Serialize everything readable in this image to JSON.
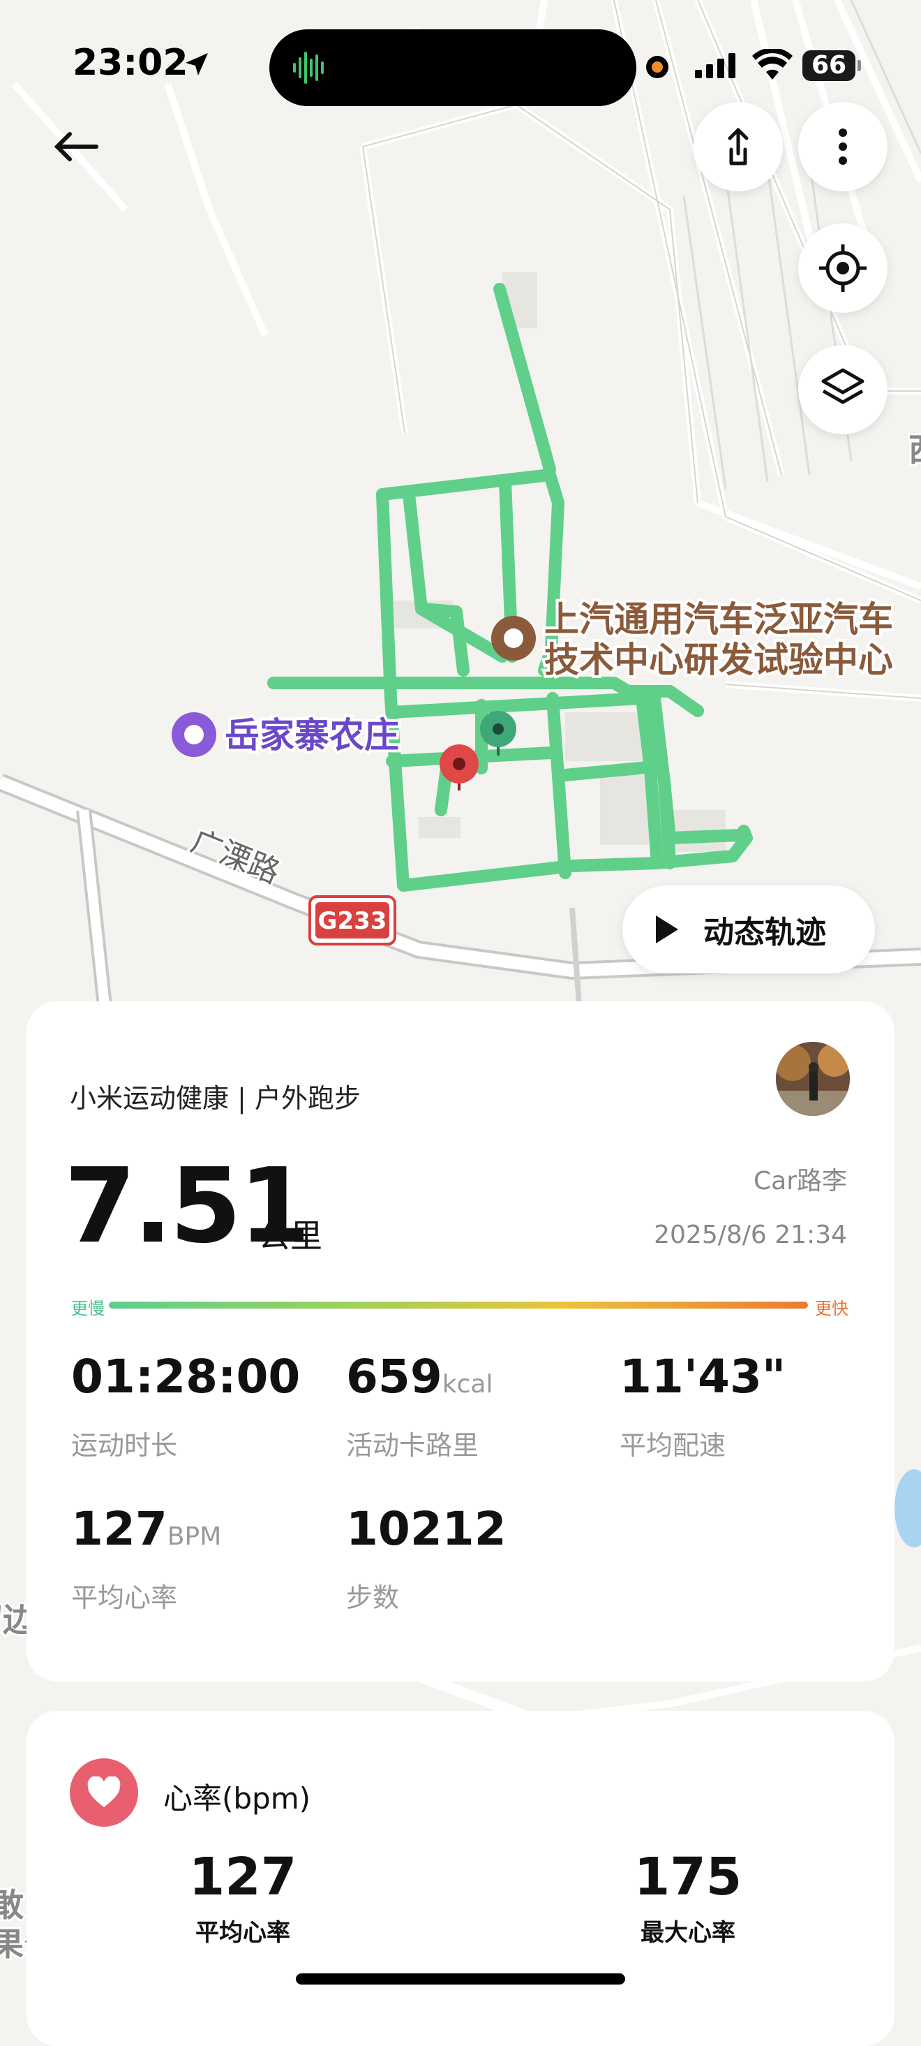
{
  "status_bar": {
    "time": "23:02",
    "battery": "66"
  },
  "map": {
    "poi_1": "上汽通用汽车泛亚汽车",
    "poi_1_line2": "技术中心研发试验中心",
    "poi_2": "岳家寨农庄",
    "road_name": "广溧路",
    "road_badge": "G233",
    "edge_text_1": "西",
    "edge_text_2": "留边",
    "edge_text_3": "敢",
    "edge_text_4": "果公",
    "route_color": "#5fcf8a"
  },
  "controls": {
    "back_icon": "arrow-left-icon",
    "share_icon": "share-icon",
    "more_icon": "more-vertical-icon",
    "locate_icon": "locate-icon",
    "layers_icon": "layers-icon",
    "dynamic_track_label": "动态轨迹"
  },
  "summary": {
    "app_title": "小米运动健康 | 户外跑步",
    "distance": "7.51",
    "distance_unit": "公里",
    "user_name": "Car路李",
    "datetime": "2025/8/6 21:34",
    "slower_label": "更慢",
    "faster_label": "更快",
    "stats": [
      {
        "value": "01:28:00",
        "unit": "",
        "label": "运动时长"
      },
      {
        "value": "659",
        "unit": "kcal",
        "label": "活动卡路里"
      },
      {
        "value": "11'43\"",
        "unit": "",
        "label": "平均配速"
      },
      {
        "value": "127",
        "unit": "BPM",
        "label": "平均心率"
      },
      {
        "value": "10212",
        "unit": "",
        "label": "步数"
      }
    ]
  },
  "heart_rate": {
    "title": "心率(bpm)",
    "avg_value": "127",
    "avg_label": "平均心率",
    "max_value": "175",
    "max_label": "最大心率"
  }
}
